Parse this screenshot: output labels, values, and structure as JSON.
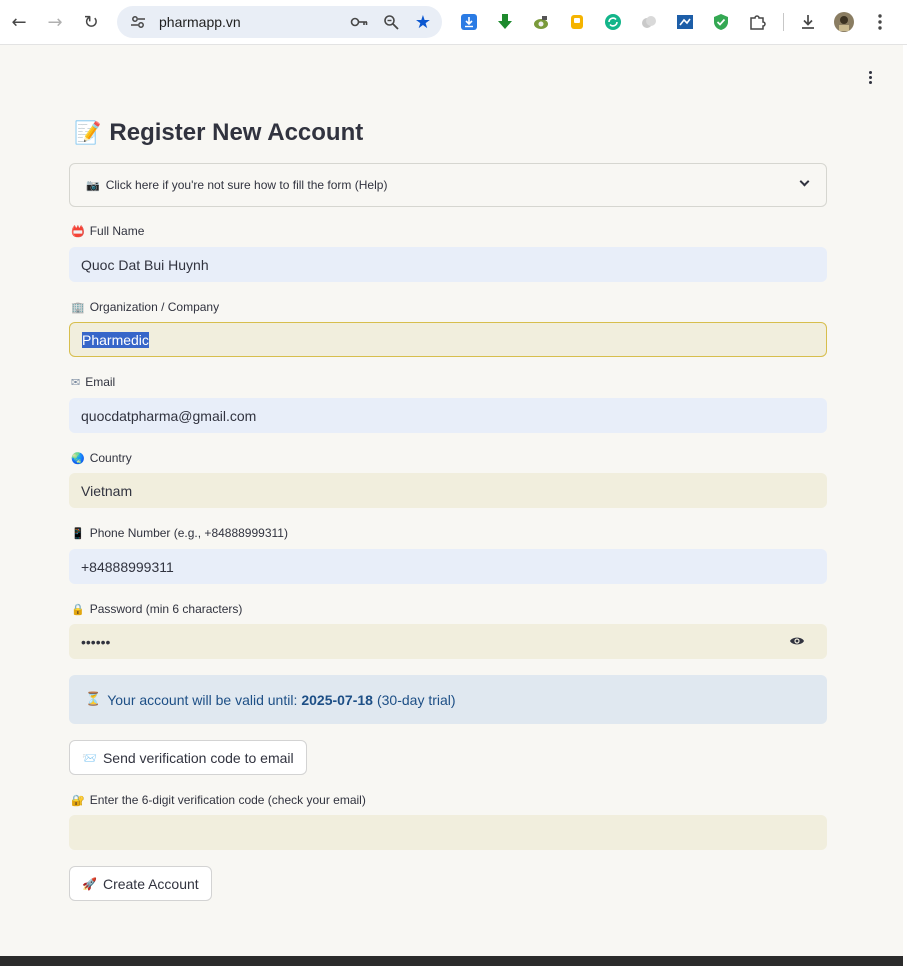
{
  "browser": {
    "url": "pharmapp.vn",
    "nav": {
      "back": "←",
      "forward": "→",
      "reload": "↻"
    },
    "icons": [
      "key-icon",
      "zoom-icon",
      "bookmark-star-icon"
    ],
    "extensions": [
      "download-arrow-extension",
      "green-arrow-extension",
      "camera-extension",
      "yellow-clip-extension",
      "refresh-extension",
      "cloud-extension",
      "screenshot-extension",
      "shield-extension",
      "puzzle-extensions-icon",
      "downloads-icon",
      "profile-avatar",
      "chrome-menu-icon"
    ]
  },
  "page": {
    "title_icon": "📝",
    "title": "Register New Account",
    "help": {
      "icon": "📷",
      "label": "Click here if you're not sure how to fill the form (Help)"
    },
    "fields": {
      "full_name": {
        "icon": "📛",
        "label": "Full Name",
        "value": "Quoc Dat Bui Huynh"
      },
      "organization": {
        "icon": "🏢",
        "label": "Organization / Company",
        "value": "Pharmedic"
      },
      "email": {
        "icon": "✉",
        "label": "Email",
        "value": "quocdatpharma@gmail.com"
      },
      "country": {
        "icon": "🌏",
        "label": "Country",
        "value": "Vietnam"
      },
      "phone": {
        "icon": "📱",
        "label": "Phone Number (e.g., +84888999311)",
        "value": "+84888999311"
      },
      "password": {
        "icon": "🔒",
        "label": "Password (min 6 characters)",
        "value": "••••••"
      },
      "verification": {
        "icon": "🔐",
        "label": "Enter the 6-digit verification code (check your email)",
        "value": ""
      }
    },
    "validity": {
      "icon": "⏳",
      "prefix": "Your account will be valid until:",
      "date": "2025-07-18",
      "suffix": "(30-day trial)"
    },
    "send_code_button": {
      "icon": "📨",
      "label": "Send verification code to email"
    },
    "create_button": {
      "icon": "🚀",
      "label": "Create Account"
    }
  },
  "colors": {
    "accent_blue": "#0b57d0",
    "info_text": "#1d4f86",
    "focus_border": "#d7be4d"
  }
}
